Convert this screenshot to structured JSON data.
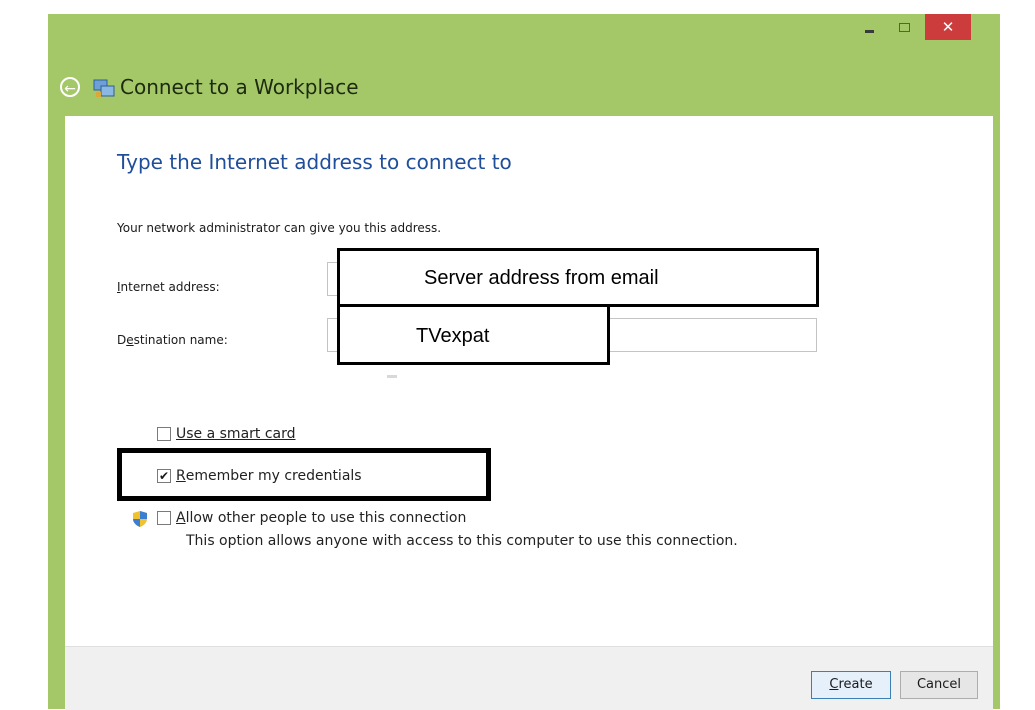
{
  "window": {
    "title": "Connect to a Workplace",
    "close_glyph": "✕",
    "back_glyph": "←",
    "icons": [
      "back-arrow-icon",
      "network-icon",
      "minimize-icon",
      "maximize-icon",
      "close-icon",
      "shield-icon"
    ]
  },
  "content": {
    "heading": "Type the Internet address to connect to",
    "description": "Your network administrator can give you this address.",
    "internet_address_label_prefix": "I",
    "internet_address_label_rest": "nternet address:",
    "destination_label_prefix": "D",
    "destination_label_mnemonic": "e",
    "destination_label_rest": "stination name:",
    "internet_address_value": "",
    "destination_value": ""
  },
  "options": {
    "smart_card": {
      "label": "Use a smart card",
      "checked": false
    },
    "remember": {
      "mnemonic": "R",
      "label_rest": "emember my credentials",
      "checked": true,
      "check_glyph": "✔"
    },
    "allow_others": {
      "mnemonic": "A",
      "label_rest": "llow other people to use this connection",
      "checked": false,
      "sublabel": "This option allows anyone with access to this computer to use this connection."
    }
  },
  "buttons": {
    "create_mnemonic": "C",
    "create_rest": "reate",
    "cancel": "Cancel"
  },
  "annotations": {
    "server_address": "Server address from email",
    "destination": "TVexpat"
  },
  "colors": {
    "frame": "#a4c868",
    "heading": "#1f4e9a",
    "close": "#cd3c3c"
  }
}
